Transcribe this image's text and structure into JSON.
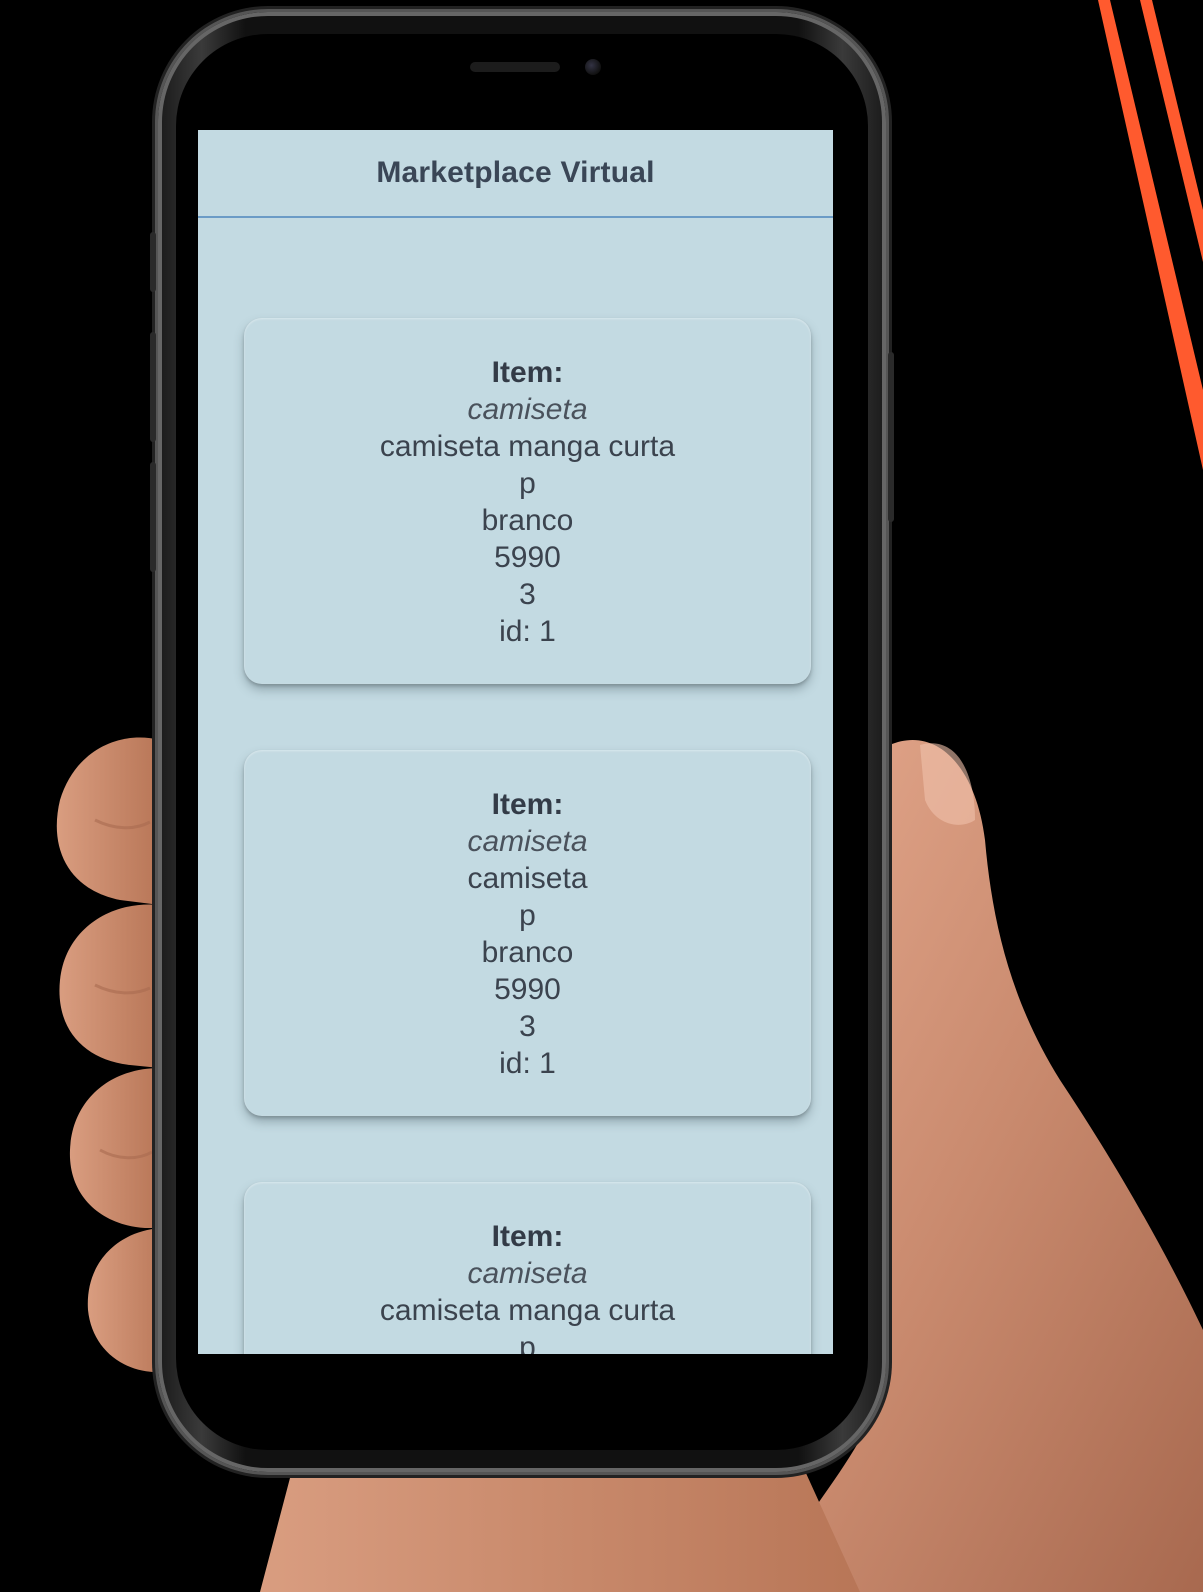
{
  "app": {
    "title": "Marketplace Virtual"
  },
  "colors": {
    "screen_background": "#c3dae2",
    "header_rule": "#6b9bc6",
    "text": "#3b434e",
    "accent_stripes": "#ff5a2e"
  },
  "items": [
    {
      "label": "Item:",
      "name": "camiseta",
      "description": "camiseta manga curta",
      "size": "p",
      "color": "branco",
      "price": "5990",
      "quantity": "3",
      "id": "id: 1"
    },
    {
      "label": "Item:",
      "name": "camiseta",
      "description": "camiseta",
      "size": "p",
      "color": "branco",
      "price": "5990",
      "quantity": "3",
      "id": "id: 1"
    },
    {
      "label": "Item:",
      "name": "camiseta",
      "description": "camiseta manga curta",
      "size": "p",
      "color": "",
      "price": "",
      "quantity": "",
      "id": ""
    }
  ]
}
